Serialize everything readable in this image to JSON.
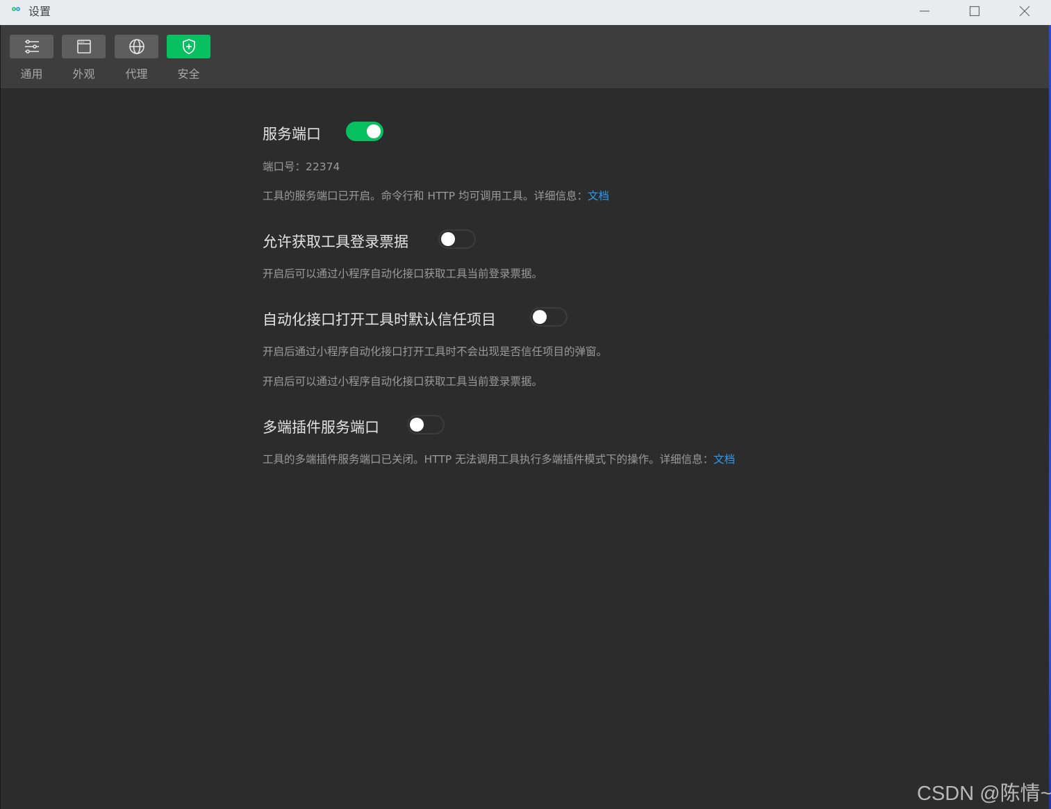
{
  "window": {
    "title": "设置",
    "icons": {
      "app": "wechat-devtools-icon",
      "minimize": "minimize-icon",
      "maximize": "maximize-icon",
      "close": "close-icon"
    }
  },
  "tabs": [
    {
      "label": "通用",
      "icon": "sliders-icon",
      "active": false
    },
    {
      "label": "外观",
      "icon": "window-icon",
      "active": false
    },
    {
      "label": "代理",
      "icon": "globe-icon",
      "active": false
    },
    {
      "label": "安全",
      "icon": "shield-plus-icon",
      "active": true
    }
  ],
  "settings": {
    "service_port": {
      "title": "服务端口",
      "enabled": true,
      "port_label": "端口号：22374",
      "desc": "工具的服务端口已开启。命令行和 HTTP 均可调用工具。详细信息：",
      "link": "文档"
    },
    "login_ticket": {
      "title": "允许获取工具登录票据",
      "enabled": false,
      "desc": "开启后可以通过小程序自动化接口获取工具当前登录票据。"
    },
    "trust_project": {
      "title": "自动化接口打开工具时默认信任项目",
      "enabled": false,
      "desc1": "开启后通过小程序自动化接口打开工具时不会出现是否信任项目的弹窗。",
      "desc2": "开启后可以通过小程序自动化接口获取工具当前登录票据。"
    },
    "multi_plugin_port": {
      "title": "多端插件服务端口",
      "enabled": false,
      "desc": "工具的多端插件服务端口已关闭。HTTP 无法调用工具执行多端插件模式下的操作。详细信息：",
      "link": "文档"
    }
  },
  "colors": {
    "accent": "#07c160",
    "link": "#2e9bf0",
    "background": "#2c2c2c",
    "toolbar": "#3d3d3d"
  },
  "watermark": "CSDN @陈情~"
}
